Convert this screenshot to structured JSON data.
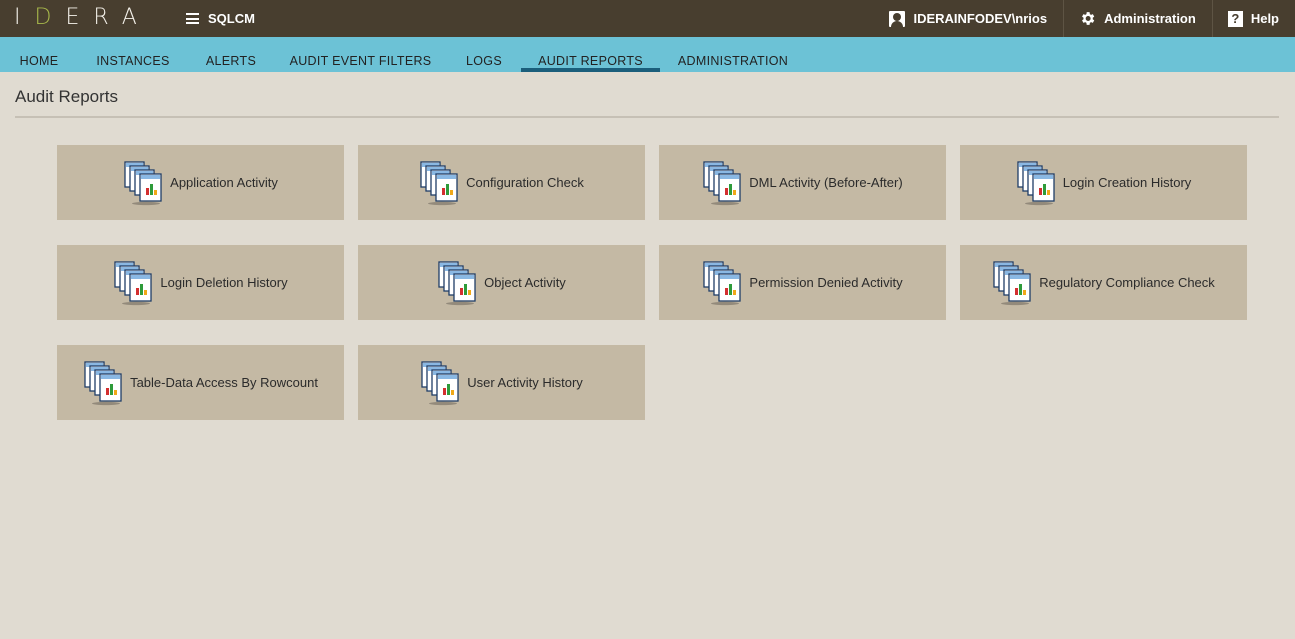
{
  "header": {
    "logo_left": "I",
    "logo_accent": "D",
    "logo_right": "ERA",
    "product": "SQLCM",
    "user": "IDERAINFODEV\\nrios",
    "admin": "Administration",
    "help_glyph": "?",
    "help": "Help",
    "accent_color": "#a7b84b"
  },
  "nav": {
    "tabs": [
      {
        "label": "HOME"
      },
      {
        "label": "INSTANCES"
      },
      {
        "label": "ALERTS"
      },
      {
        "label": "AUDIT EVENT FILTERS"
      },
      {
        "label": "LOGS"
      },
      {
        "label": "AUDIT REPORTS"
      },
      {
        "label": "ADMINISTRATION"
      }
    ],
    "active": "AUDIT REPORTS"
  },
  "page": {
    "title": "Audit Reports"
  },
  "reports": [
    {
      "label": "Application Activity",
      "icon": "report-stack-icon"
    },
    {
      "label": "Configuration Check",
      "icon": "report-stack-icon"
    },
    {
      "label": "DML Activity (Before-After)",
      "icon": "report-stack-icon"
    },
    {
      "label": "Login Creation History",
      "icon": "report-stack-icon"
    },
    {
      "label": "Login Deletion History",
      "icon": "report-stack-icon"
    },
    {
      "label": "Object Activity",
      "icon": "report-stack-icon"
    },
    {
      "label": "Permission Denied Activity",
      "icon": "report-stack-icon"
    },
    {
      "label": "Regulatory Compliance Check",
      "icon": "report-stack-icon"
    },
    {
      "label": "Table-Data Access By Rowcount",
      "icon": "report-stack-icon"
    },
    {
      "label": "User Activity History",
      "icon": "report-stack-icon"
    }
  ]
}
